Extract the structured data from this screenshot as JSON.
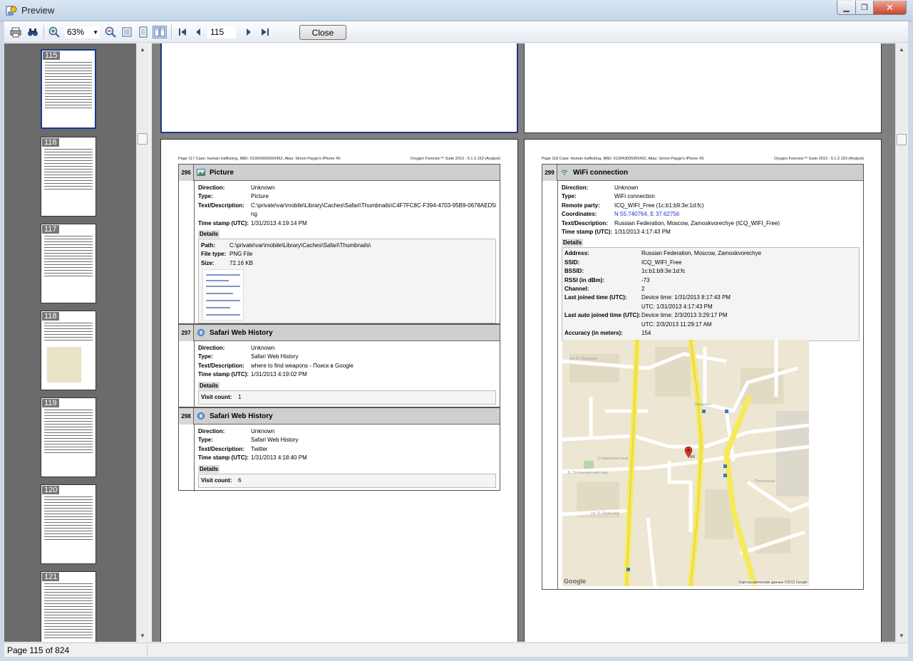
{
  "window": {
    "title": "Preview"
  },
  "toolbar": {
    "zoom": "63%",
    "page_number": "115",
    "close_label": "Close"
  },
  "thumbnails": [
    {
      "number": "115"
    },
    {
      "number": "116"
    },
    {
      "number": "117"
    },
    {
      "number": "118"
    },
    {
      "number": "119"
    },
    {
      "number": "120"
    },
    {
      "number": "121"
    }
  ],
  "left_page": {
    "header_left": "Page  117       Case: Human trafficking, IMEI: 013043005065452, Alias: Simon Payge's iPhone 4S",
    "header_right": "Oxygen Forensic™ Suite 2013 - 5.1.2.153 (Analyst)",
    "records": [
      {
        "number": "296",
        "title": "Picture",
        "fields": [
          {
            "k": "Direction:",
            "v": "Unknown"
          },
          {
            "k": "Type:",
            "v": "Picture"
          },
          {
            "k": "Text/Description:",
            "v": "C:\\private\\var\\mobile\\Library\\Caches\\Safari\\Thumbnails\\C4F7FC8C-F394-4703-95B9-0678AED5F06F.p"
          },
          {
            "k": "",
            "v": "ng"
          },
          {
            "k": "Time stamp (UTC):",
            "v": "1/31/2013 4:19:14 PM"
          }
        ],
        "details_label": "Details",
        "details": [
          {
            "k": "Path:",
            "v": "C:\\private\\var\\mobile\\Library\\Caches\\Safari\\Thumbnails\\"
          },
          {
            "k": "File type:",
            "v": "PNG File"
          },
          {
            "k": "Size:",
            "v": "72.16 KB"
          }
        ]
      },
      {
        "number": "297",
        "title": "Safari Web History",
        "fields": [
          {
            "k": "Direction:",
            "v": "Unknown"
          },
          {
            "k": "Type:",
            "v": "Safari Web History"
          },
          {
            "k": "Text/Description:",
            "v": "where to find weapons - Поиск в Google"
          },
          {
            "k": "Time stamp (UTC):",
            "v": "1/31/2013 4:19:02 PM"
          }
        ],
        "details_label": "Details",
        "details": [
          {
            "k": "Visit count:",
            "v": "1"
          }
        ]
      },
      {
        "number": "298",
        "title": "Safari Web History",
        "fields": [
          {
            "k": "Direction:",
            "v": "Unknown"
          },
          {
            "k": "Type:",
            "v": "Safari Web History"
          },
          {
            "k": "Text/Description:",
            "v": "Twitter"
          },
          {
            "k": "Time stamp (UTC):",
            "v": "1/31/2013 4:18:40 PM"
          }
        ],
        "details_label": "Details",
        "details": [
          {
            "k": "Visit count:",
            "v": "6"
          }
        ]
      }
    ]
  },
  "right_page": {
    "header_left": "Page  118       Case: Human trafficking, IMEI: 013043005065452, Alias: Simon Payge's iPhone 4S",
    "header_right": "Oxygen Forensic™ Suite 2013 - 5.1.2.153 (Analyst)",
    "record": {
      "number": "299",
      "title": "WiFi connection",
      "fields": [
        {
          "k": "Direction:",
          "v": "Unknown"
        },
        {
          "k": "Type:",
          "v": "WiFi connection"
        },
        {
          "k": "Remote party:",
          "v": "ICQ_WIFI_Free (1c:b1:b9:3e:1d:fc)"
        },
        {
          "k": "Coordinates:",
          "v": "N 55.740764, E 37.62756"
        },
        {
          "k": "Text/Description:",
          "v": "Russian Federation, Moscow, Zamoskvorechye (ICQ_WIFI_Free)"
        },
        {
          "k": "Time stamp (UTC):",
          "v": "1/31/2013 4:17:43 PM"
        }
      ],
      "details_label": "Details",
      "details": [
        {
          "k": "Address:",
          "v": "Russian Federation, Moscow, Zamoskvorechye"
        },
        {
          "k": "SSID:",
          "v": "ICQ_WIFI_Free"
        },
        {
          "k": "BSSID:",
          "v": "1c:b1:b9:3e:1d:fc"
        },
        {
          "k": "RSSI (in dBm):",
          "v": "-73"
        },
        {
          "k": "Channel:",
          "v": "2"
        },
        {
          "k": "Last joined time (UTC):",
          "v": "Device time: 1/31/2013 8:17:43 PM"
        },
        {
          "k": "",
          "v": "UTC: 1/31/2013 4:17:43 PM"
        },
        {
          "k": "Last auto joined time (UTC):",
          "v": "Device time: 2/3/2013 3:29:17 PM"
        },
        {
          "k": "",
          "v": "UTC: 2/3/2013 11:29:17 AM"
        },
        {
          "k": "Accuracy (in meters):",
          "v": "154"
        }
      ],
      "map_google": "Google",
      "map_copyright": "Картографические данные ©2013 Google"
    }
  },
  "status": {
    "text": "Page 115 of 824"
  }
}
